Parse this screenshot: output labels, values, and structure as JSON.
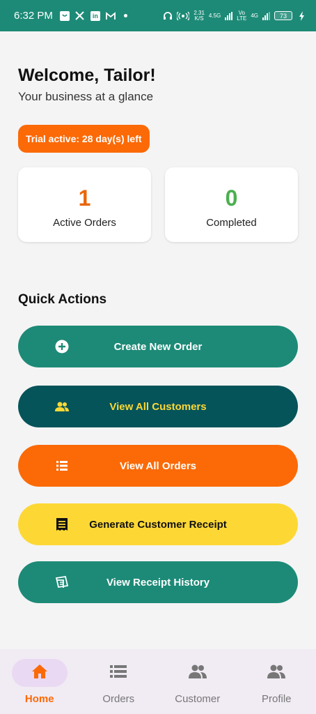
{
  "status_bar": {
    "time": "6:32 PM",
    "net_speed_value": "2.31",
    "net_speed_unit": "K/S",
    "net_4g5g": "4.5G",
    "volte": "Vo",
    "lte": "LTE",
    "net_4g": "4G",
    "battery": "73"
  },
  "header": {
    "title": "Welcome, Tailor!",
    "subtitle": "Your business at a glance"
  },
  "trial": {
    "text": "Trial active: 28 day(s) left"
  },
  "stats": [
    {
      "value": "1",
      "label": "Active Orders",
      "color": "#e9660a"
    },
    {
      "value": "0",
      "label": "Completed",
      "color": "#4caf50"
    }
  ],
  "quick_actions": {
    "title": "Quick Actions",
    "buttons": [
      {
        "label": "Create New Order",
        "icon": "add-circle-icon",
        "bg": "#1d8a77",
        "fg": "#ffffff"
      },
      {
        "label": "View All Customers",
        "icon": "people-icon",
        "bg": "#055459",
        "fg": "#fdd835"
      },
      {
        "label": "View All Orders",
        "icon": "list-icon",
        "bg": "#fb6a07",
        "fg": "#ffffff"
      },
      {
        "label": "Generate Customer Receipt",
        "icon": "receipt-icon",
        "bg": "#fdd835",
        "fg": "#111111"
      },
      {
        "label": "View Receipt History",
        "icon": "receipt-history-icon",
        "bg": "#1d8a77",
        "fg": "#ffffff"
      }
    ]
  },
  "bottom_nav": {
    "items": [
      {
        "label": "Home",
        "icon": "home-icon",
        "active": true
      },
      {
        "label": "Orders",
        "icon": "list-icon",
        "active": false
      },
      {
        "label": "Customer",
        "icon": "people-icon",
        "active": false
      },
      {
        "label": "Profile",
        "icon": "people-icon",
        "active": false
      }
    ]
  },
  "colors": {
    "primary": "#1d8a77",
    "accent": "#fb6a07",
    "dark_teal": "#055459",
    "yellow": "#fdd835",
    "nav_bg": "#f1ebf4"
  }
}
